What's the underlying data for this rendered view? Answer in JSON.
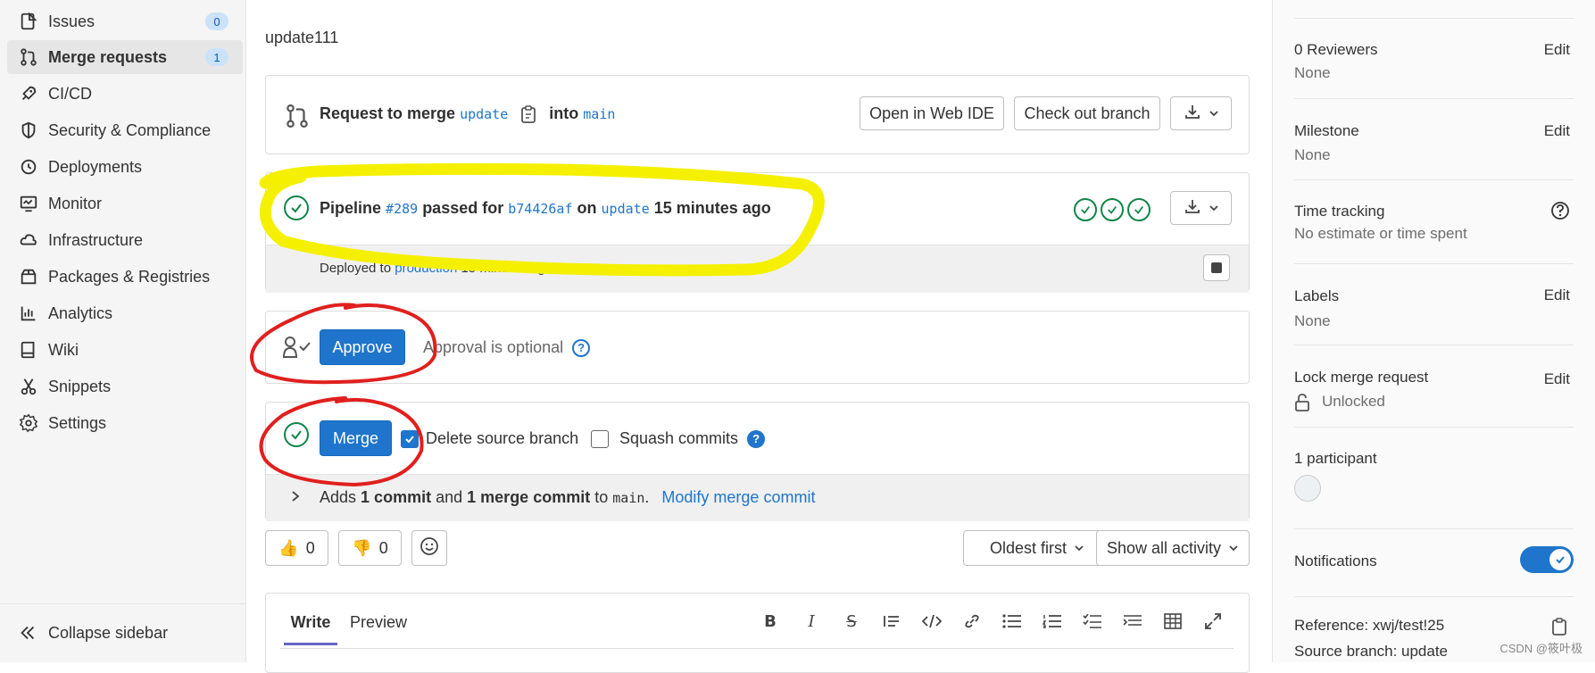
{
  "sidebar": {
    "items": [
      {
        "label": "Issues",
        "icon": "issues-icon",
        "badge": "0"
      },
      {
        "label": "Merge requests",
        "icon": "merge-request-icon",
        "badge": "1"
      },
      {
        "label": "CI/CD",
        "icon": "rocket-icon"
      },
      {
        "label": "Security & Compliance",
        "icon": "shield-icon"
      },
      {
        "label": "Deployments",
        "icon": "deployments-icon"
      },
      {
        "label": "Monitor",
        "icon": "monitor-icon"
      },
      {
        "label": "Infrastructure",
        "icon": "cloud-gear-icon"
      },
      {
        "label": "Packages & Registries",
        "icon": "package-icon"
      },
      {
        "label": "Analytics",
        "icon": "chart-icon"
      },
      {
        "label": "Wiki",
        "icon": "book-icon"
      },
      {
        "label": "Snippets",
        "icon": "scissors-icon"
      },
      {
        "label": "Settings",
        "icon": "gear-icon"
      }
    ],
    "collapse_label": "Collapse sidebar"
  },
  "main": {
    "branch_title": "update111",
    "merge_request": {
      "prefix": "Request to merge",
      "source_branch": "update",
      "into": "into",
      "target_branch": "main",
      "open_web_ide": "Open in Web IDE",
      "checkout_branch": "Check out branch"
    },
    "pipeline": {
      "label": "Pipeline",
      "id": "#289",
      "passed_for": "passed for",
      "commit": "b74426af",
      "on": "on",
      "branch": "update",
      "time": "15 minutes ago",
      "deployed_to": "Deployed to",
      "environment": "production",
      "deployed_time": "15 minutes ago"
    },
    "approval": {
      "approve_label": "Approve",
      "optional_text": "Approval is optional"
    },
    "merge": {
      "merge_label": "Merge",
      "delete_source": "Delete source branch",
      "squash": "Squash commits",
      "adds": "Adds",
      "commit_count": "1 commit",
      "and": "and",
      "merge_commit_count": "1 merge commit",
      "to": "to",
      "target": "main",
      "period": ".",
      "modify": "Modify merge commit"
    },
    "reactions": {
      "thumbs_up": "0",
      "thumbs_down": "0"
    },
    "sort_label": "Oldest first",
    "activity_label": "Show all activity",
    "editor": {
      "write_tab": "Write",
      "preview_tab": "Preview"
    }
  },
  "right_sidebar": {
    "reviewers_label": "0 Reviewers",
    "reviewers_value": "None",
    "milestone_label": "Milestone",
    "milestone_value": "None",
    "time_tracking_label": "Time tracking",
    "time_tracking_value": "No estimate or time spent",
    "labels_label": "Labels",
    "labels_value": "None",
    "lock_label": "Lock merge request",
    "lock_value": "Unlocked",
    "participants_label": "1 participant",
    "notifications_label": "Notifications",
    "reference": "Reference: xwj/test!25",
    "source_branch": "Source branch: update",
    "edit_label": "Edit"
  },
  "watermark": "CSDN @筱叶极",
  "colors": {
    "accent": "#1f75cb",
    "success": "#108548",
    "annotation_yellow": "#f5f000",
    "annotation_red": "#e0201e"
  }
}
